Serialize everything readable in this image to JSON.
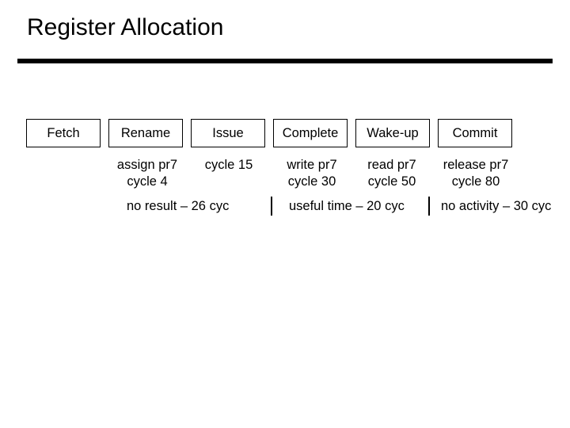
{
  "title": "Register Allocation",
  "stages": {
    "fetch": "Fetch",
    "rename": "Rename",
    "issue": "Issue",
    "complete": "Complete",
    "wakeup": "Wake-up",
    "commit": "Commit"
  },
  "annotations": {
    "rename": {
      "line1": "assign pr7",
      "line2": "cycle 4"
    },
    "issue": {
      "line1": "",
      "line2": "cycle 15"
    },
    "complete": {
      "line1": "write pr7",
      "line2": "cycle 30"
    },
    "wakeup": {
      "line1": "read pr7",
      "line2": "cycle 50"
    },
    "commit": {
      "line1": "release pr7",
      "line2": "cycle 80"
    }
  },
  "spans": {
    "no_result": "no result – 26 cyc",
    "useful_time": "useful time – 20 cyc",
    "no_activity": "no activity – 30 cyc"
  }
}
